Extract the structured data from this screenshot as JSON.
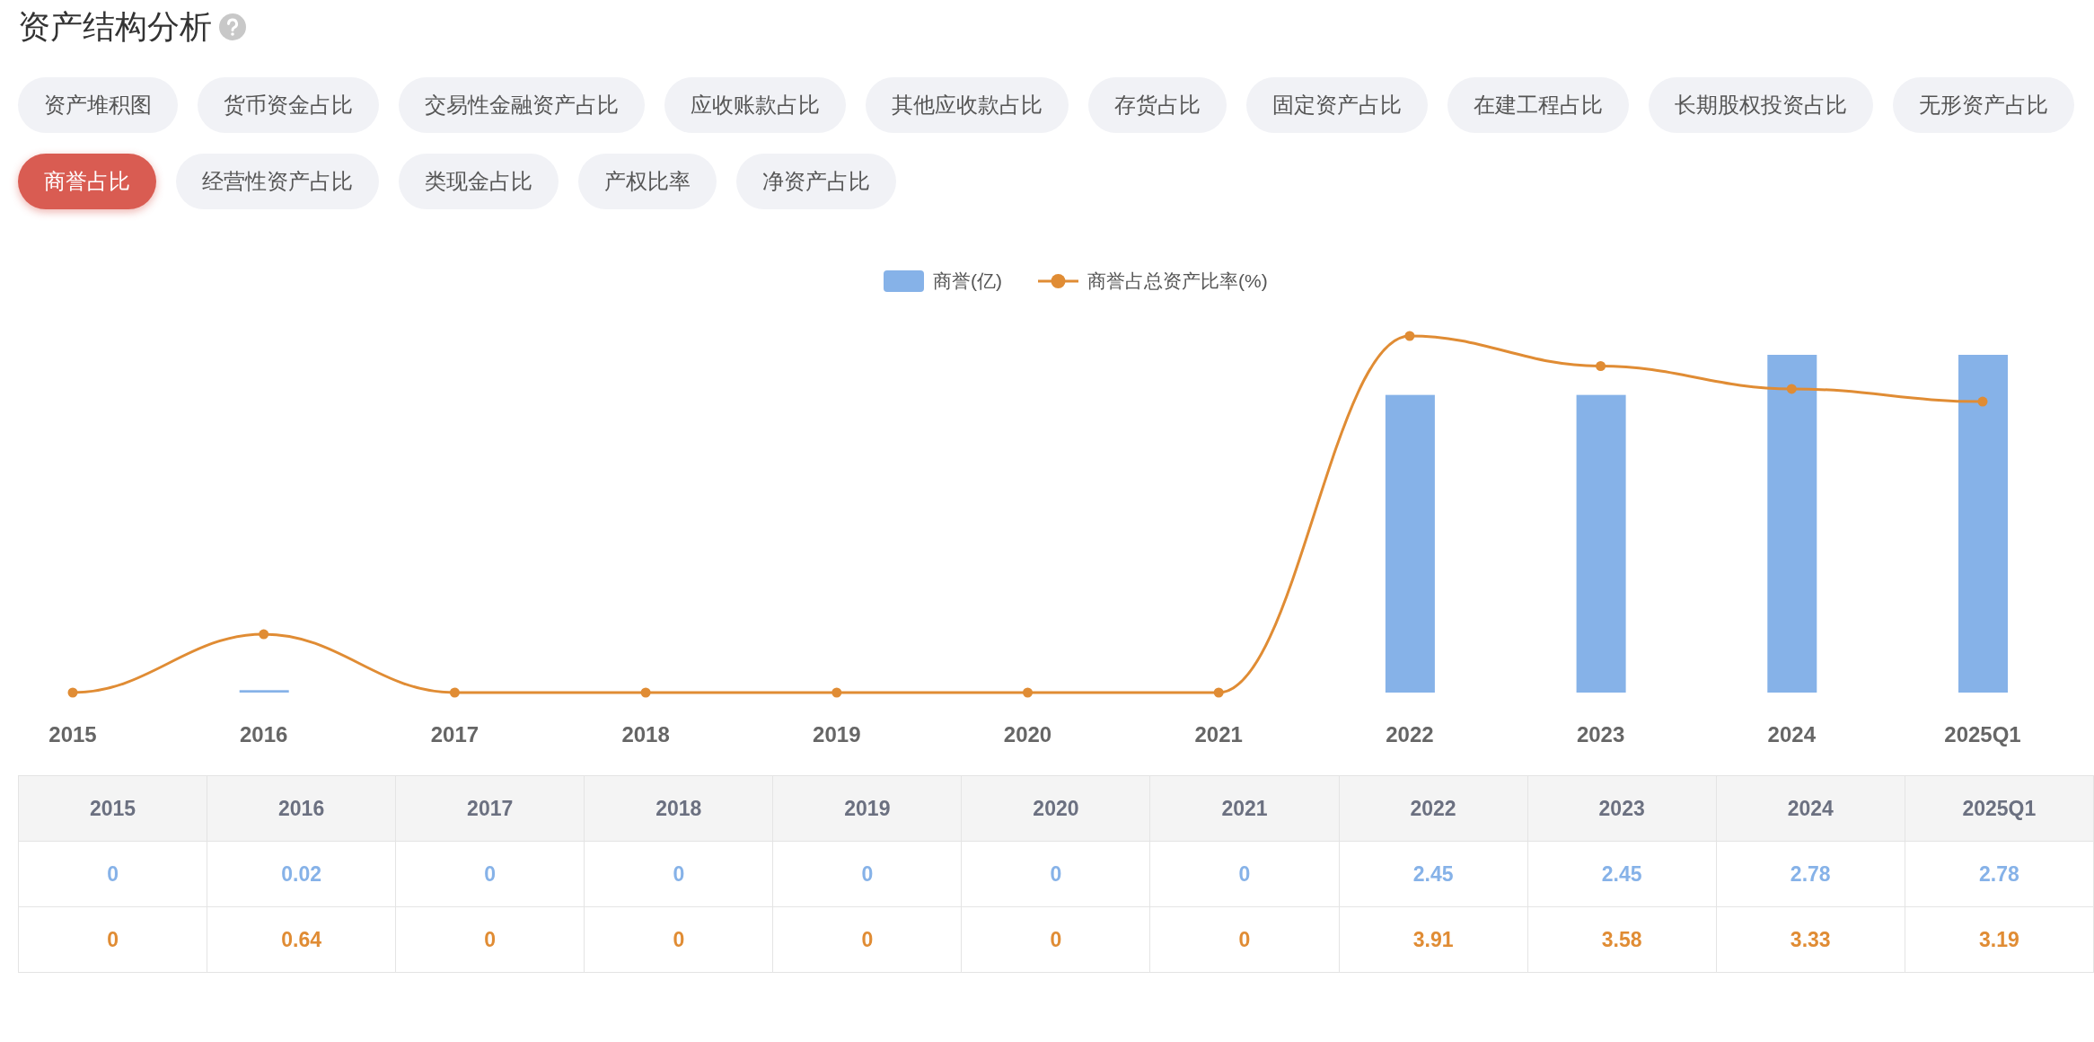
{
  "title": "资产结构分析",
  "tabs": [
    {
      "label": "资产堆积图",
      "selected": false
    },
    {
      "label": "货币资金占比",
      "selected": false
    },
    {
      "label": "交易性金融资产占比",
      "selected": false
    },
    {
      "label": "应收账款占比",
      "selected": false
    },
    {
      "label": "其他应收款占比",
      "selected": false
    },
    {
      "label": "存货占比",
      "selected": false
    },
    {
      "label": "固定资产占比",
      "selected": false
    },
    {
      "label": "在建工程占比",
      "selected": false
    },
    {
      "label": "长期股权投资占比",
      "selected": false
    },
    {
      "label": "无形资产占比",
      "selected": false
    },
    {
      "label": "商誉占比",
      "selected": true
    },
    {
      "label": "经营性资产占比",
      "selected": false
    },
    {
      "label": "类现金占比",
      "selected": false
    },
    {
      "label": "产权比率",
      "selected": false
    },
    {
      "label": "净资产占比",
      "selected": false
    }
  ],
  "chart": {
    "legend": [
      {
        "label": "商誉(亿)",
        "kind": "bar",
        "color": "#86b2e8"
      },
      {
        "label": "商誉占总资产比率(%)",
        "kind": "line",
        "color": "#e08c34"
      }
    ],
    "x_labels": [
      "2015",
      "2016",
      "2017",
      "2018",
      "2019",
      "2020",
      "2021",
      "2022",
      "2023",
      "2024",
      "2025Q1"
    ]
  },
  "table": {
    "columns": [
      "2015",
      "2016",
      "2017",
      "2018",
      "2019",
      "2020",
      "2021",
      "2022",
      "2023",
      "2024",
      "2025Q1"
    ],
    "rows": [
      {
        "color": "#86b2e8",
        "cells": [
          "0",
          "0.02",
          "0",
          "0",
          "0",
          "0",
          "0",
          "2.45",
          "2.45",
          "2.78",
          "2.78"
        ]
      },
      {
        "color": "#e08c34",
        "cells": [
          "0",
          "0.64",
          "0",
          "0",
          "0",
          "0",
          "0",
          "3.91",
          "3.58",
          "3.33",
          "3.19"
        ]
      }
    ]
  }
}
